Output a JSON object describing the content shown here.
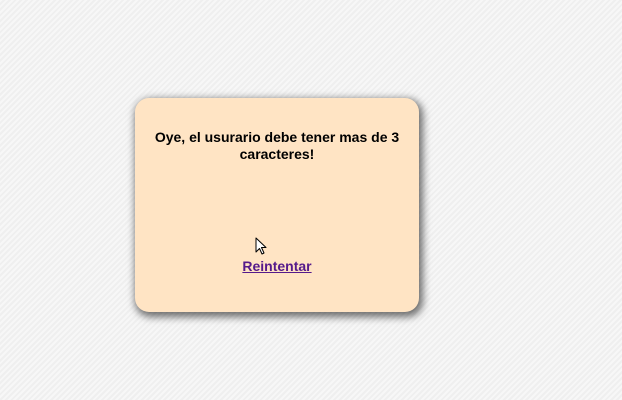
{
  "dialog": {
    "message": "Oye, el usurario debe tener mas de 3 caracteres!",
    "retry_label": "Reintentar",
    "background_color": "#ffe4c4",
    "link_color": "#551a8b"
  },
  "cursor": {
    "icon": "arrow-pointer-icon"
  }
}
